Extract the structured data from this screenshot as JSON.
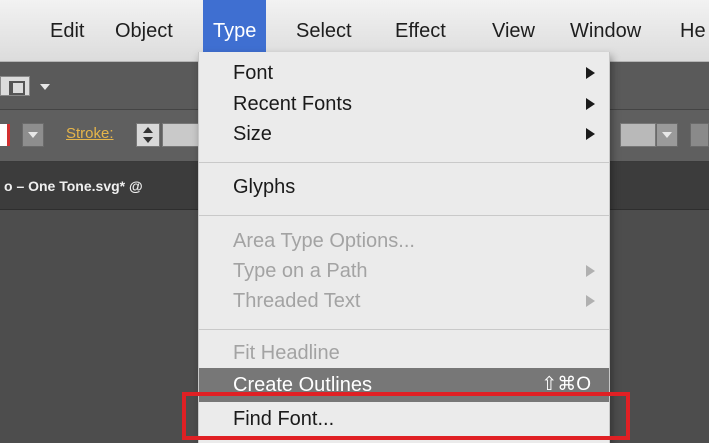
{
  "menubar": {
    "items": [
      "Edit",
      "Object",
      "Type",
      "Select",
      "Effect",
      "View",
      "Window",
      "He"
    ],
    "active_index": 2
  },
  "toolbar": {
    "stroke_label": "Stroke:"
  },
  "document_tab": {
    "title": "o – One Tone.svg* @"
  },
  "type_menu": {
    "items": [
      {
        "label": "Font",
        "submenu": true,
        "enabled": true
      },
      {
        "label": "Recent Fonts",
        "submenu": true,
        "enabled": true
      },
      {
        "label": "Size",
        "submenu": true,
        "enabled": true
      },
      {
        "label": "Glyphs",
        "submenu": false,
        "enabled": true
      },
      {
        "label": "Area Type Options...",
        "submenu": false,
        "enabled": false
      },
      {
        "label": "Type on a Path",
        "submenu": true,
        "enabled": false
      },
      {
        "label": "Threaded Text",
        "submenu": true,
        "enabled": false
      },
      {
        "label": "Fit Headline",
        "submenu": false,
        "enabled": false
      },
      {
        "label": "Create Outlines",
        "submenu": false,
        "enabled": true,
        "highlighted": true,
        "shortcut": "⇧⌘O"
      },
      {
        "label": "Find Font...",
        "submenu": false,
        "enabled": true,
        "annotated": true
      }
    ]
  },
  "colors": {
    "menu_active": "#3f6fd1",
    "menu_highlight": "#777777",
    "annotation_box": "#e02024",
    "stroke_label": "#e6b54a"
  }
}
